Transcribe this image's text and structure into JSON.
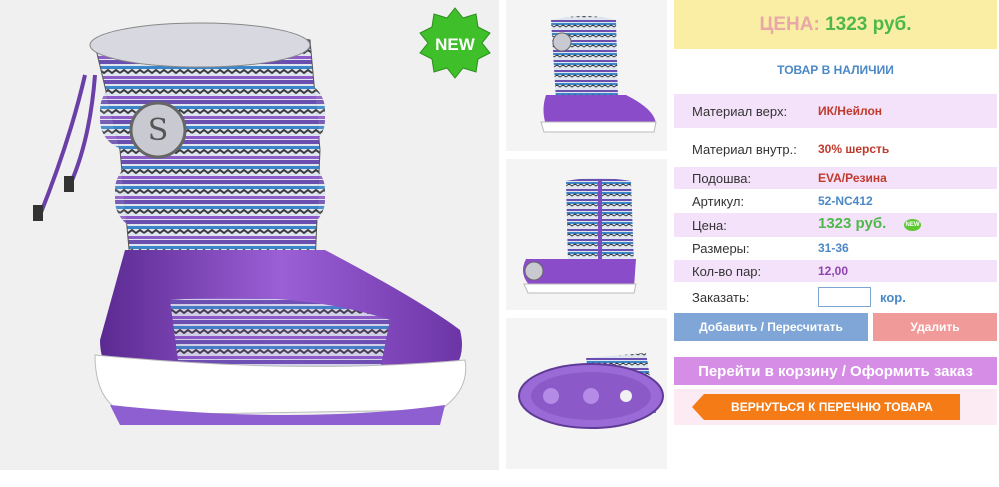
{
  "product": {
    "main_image": "purple knit winter boot",
    "new_badge": "NEW",
    "thumbnails": [
      {
        "name": "boot-front-view"
      },
      {
        "name": "boot-side-view"
      },
      {
        "name": "boot-sole-view"
      }
    ]
  },
  "price_banner": {
    "label": "ЦЕНА:",
    "value": "1323 руб."
  },
  "availability": "ТОВАР В НАЛИЧИИ",
  "specs": {
    "material_top": {
      "label": "Материал верх:",
      "value": "ИК/Нейлон"
    },
    "material_inner": {
      "label": "Материал внутр.:",
      "value": "30% шерсть"
    },
    "sole": {
      "label": "Подошва:",
      "value": "EVA/Резина"
    },
    "sku": {
      "label": "Артикул:",
      "value": "52-NC412"
    },
    "price": {
      "label": "Цена:",
      "value": "1323 руб.",
      "badge": "NEW"
    },
    "sizes": {
      "label": "Размеры:",
      "value": "31-36"
    },
    "qty": {
      "label": "Кол-во пар:",
      "value": "12,00"
    },
    "order": {
      "label": "Заказать:",
      "input_value": "",
      "unit": "кор."
    }
  },
  "buttons": {
    "add": "Добавить / Пересчитать",
    "delete": "Удалить",
    "cart": "Перейти в корзину / Оформить заказ",
    "back": "ВЕРНУТЬСЯ К ПЕРЕЧНЮ ТОВАРА"
  },
  "colors": {
    "accent_green": "#4fb84a",
    "accent_blue": "#4a88c6",
    "banner_yellow": "#f9eea3",
    "row_highlight": "#f4e2fa",
    "cart_button": "#d58de6",
    "back_button": "#f47b16"
  }
}
